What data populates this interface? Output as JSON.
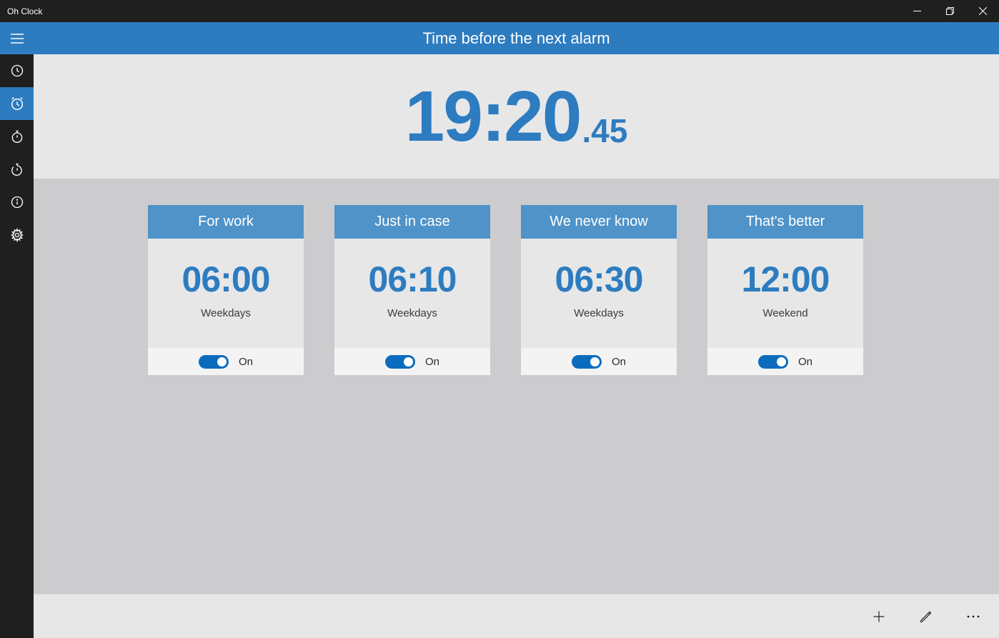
{
  "window": {
    "title": "Oh Clock"
  },
  "header": {
    "label": "Time before the next alarm"
  },
  "countdown": {
    "hhmm": "19:20",
    "sec": ".45"
  },
  "toggle_label": "On",
  "alarms": [
    {
      "title": "For work",
      "time": "06:00",
      "days": "Weekdays",
      "state": "On"
    },
    {
      "title": "Just in case",
      "time": "06:10",
      "days": "Weekdays",
      "state": "On"
    },
    {
      "title": "We never know",
      "time": "06:30",
      "days": "Weekdays",
      "state": "On"
    },
    {
      "title": "That's better",
      "time": "12:00",
      "days": "Weekend",
      "state": "On"
    }
  ]
}
